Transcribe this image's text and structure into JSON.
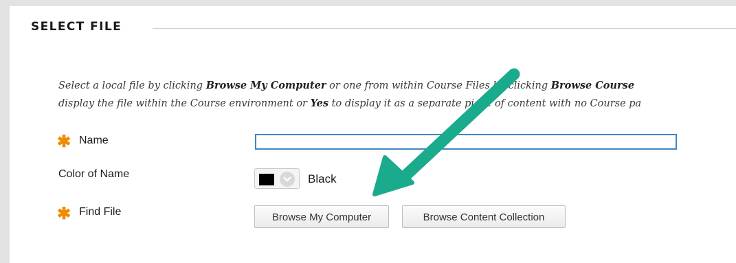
{
  "section": {
    "title": "SELECT FILE"
  },
  "instructions": {
    "line1_a": "Select a local file by clicking ",
    "line1_b": "Browse My Computer",
    "line1_c": " or one from within Course Files by clicking ",
    "line1_d": "Browse Course",
    "line2_a": "display the file within the Course environment or ",
    "line2_b": "Yes",
    "line2_c": " to display it as a separate piece of content with no Course pa"
  },
  "form": {
    "name_label": "Name",
    "name_value": "",
    "color_label": "Color of Name",
    "color_value": "Black",
    "find_file_label": "Find File",
    "browse_computer_label": "Browse My Computer",
    "browse_collection_label": "Browse Content Collection"
  },
  "colors": {
    "required": "#f08a00",
    "annotation_arrow": "#1aaa8c",
    "input_border": "#3f86c6"
  },
  "icons": {
    "required": "asterisk-icon",
    "dropdown": "chevron-down-icon",
    "annotation": "arrow-icon"
  }
}
